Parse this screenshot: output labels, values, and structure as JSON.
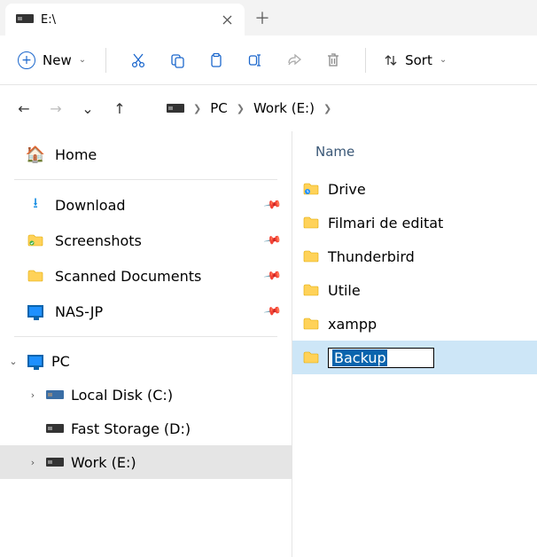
{
  "tab": {
    "title": "E:\\"
  },
  "toolbar": {
    "new": "New",
    "sort": "Sort"
  },
  "breadcrumb": {
    "pc": "PC",
    "drive": "Work (E:)"
  },
  "sidebar": {
    "home": "Home",
    "quick": [
      {
        "label": "Download"
      },
      {
        "label": "Screenshots"
      },
      {
        "label": "Scanned Documents"
      },
      {
        "label": "NAS-JP"
      }
    ],
    "pc": "PC",
    "drives": [
      {
        "label": "Local Disk (C:)"
      },
      {
        "label": "Fast Storage (D:)"
      },
      {
        "label": "Work (E:)"
      }
    ]
  },
  "content": {
    "header_name": "Name",
    "items": [
      {
        "label": "Drive"
      },
      {
        "label": "Filmari de editat"
      },
      {
        "label": "Thunderbird"
      },
      {
        "label": "Utile"
      },
      {
        "label": "xampp"
      }
    ],
    "rename_value": "Backup"
  }
}
